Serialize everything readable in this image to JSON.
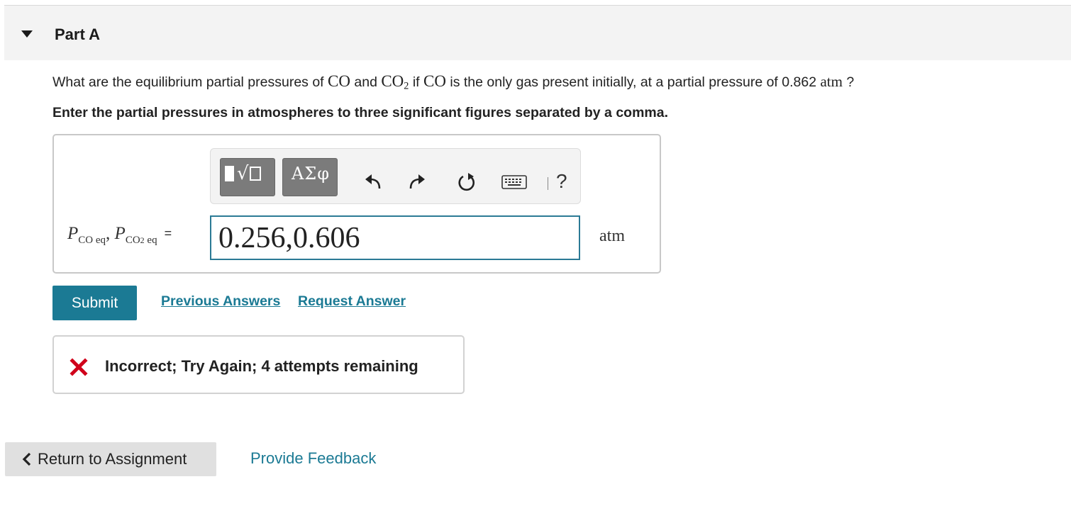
{
  "part": {
    "title": "Part A"
  },
  "question": {
    "t1": "What are the equilibrium partial pressures of ",
    "co": "CO",
    "t2": " and ",
    "co2_base": "CO",
    "co2_sub": "2",
    "t3": " if ",
    "co3": "CO",
    "t4": " is the only gas present initially, at a partial pressure of 0.862 ",
    "unit": "atm",
    "t5": " ?"
  },
  "instruction": "Enter the partial pressures in atmospheres to three significant figures separated by a comma.",
  "toolbar": {
    "symbols_label": "ΑΣφ",
    "help_label": "?",
    "icons": [
      "templates-icon",
      "greek-symbols-icon",
      "undo-icon",
      "redo-icon",
      "reset-icon",
      "keyboard-icon",
      "help-icon"
    ]
  },
  "answer": {
    "var1": "P",
    "var1_sub": "CO eq",
    "sep": ", ",
    "var2": "P",
    "var2_sub": "CO",
    "var2_sub2": "2",
    "var2_sub3": " eq",
    "equals": "=",
    "value": "0.256,0.606",
    "unit": "atm"
  },
  "actions": {
    "submit_label": "Submit",
    "previous_answers_label": "Previous Answers",
    "request_answer_label": "Request Answer"
  },
  "feedback": {
    "message": "Incorrect; Try Again; 4 attempts remaining"
  },
  "footer": {
    "return_label": "Return to Assignment",
    "provide_feedback_label": "Provide Feedback"
  },
  "colors": {
    "accent": "#1b7a94",
    "error": "#d0021b",
    "toolbar_button": "#7b7b7b",
    "header_bg": "#f3f3f3"
  }
}
